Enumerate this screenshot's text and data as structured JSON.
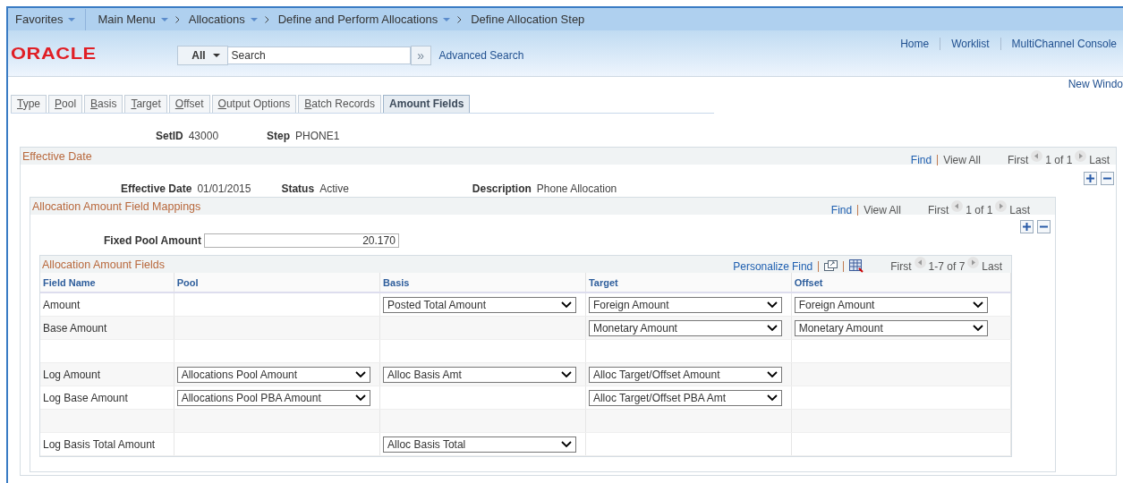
{
  "nav": {
    "items": [
      {
        "label": "Favorites",
        "has_menu": true,
        "separator": false
      },
      {
        "label": "Main Menu",
        "has_menu": true,
        "separator": false
      },
      {
        "label": "Allocations",
        "has_menu": true,
        "separator": true
      },
      {
        "label": "Define and Perform Allocations",
        "has_menu": true,
        "separator": true
      },
      {
        "label": "Define Allocation Step",
        "has_menu": false,
        "separator": true
      }
    ]
  },
  "header": {
    "logo": "ORACLE",
    "search_scope": "All",
    "search_placeholder": "Search",
    "search_go": "»",
    "advanced_search": "Advanced Search",
    "links": [
      "Home",
      "Worklist",
      "MultiChannel Console"
    ]
  },
  "new_window": "New Windo",
  "tabs": [
    {
      "label": "Type",
      "selected": false
    },
    {
      "label": "Pool",
      "selected": false
    },
    {
      "label": "Basis",
      "selected": false
    },
    {
      "label": "Target",
      "selected": false
    },
    {
      "label": "Offset",
      "selected": false
    },
    {
      "label": "Output Options",
      "selected": false
    },
    {
      "label": "Batch Records",
      "selected": false
    },
    {
      "label": "Amount Fields",
      "selected": true
    }
  ],
  "keys": [
    {
      "label": "SetID",
      "value": "43000"
    },
    {
      "label": "Step",
      "value": "PHONE1"
    }
  ],
  "effective_date_section": {
    "title": "Effective Date",
    "find": "Find",
    "view_all": "View All",
    "first": "First",
    "count": "1 of 1",
    "last": "Last",
    "fields": [
      {
        "label": "Effective Date",
        "value": "01/01/2015"
      },
      {
        "label": "Status",
        "value": "Active"
      },
      {
        "label": "Description",
        "value": "Phone Allocation"
      }
    ]
  },
  "mapping_section": {
    "title": "Allocation Amount Field Mappings",
    "find": "Find",
    "view_all": "View All",
    "first": "First",
    "count": "1 of 1",
    "last": "Last",
    "fixed_pool_label": "Fixed Pool Amount",
    "fixed_pool_value": "20.170"
  },
  "grid": {
    "title": "Allocation Amount Fields",
    "personalize": "Personalize",
    "find": "Find",
    "first": "First",
    "count": "1-7 of 7",
    "last": "Last",
    "columns": [
      "Field Name",
      "Pool",
      "Basis",
      "Target",
      "Offset"
    ],
    "rows": [
      {
        "cells": [
          "Amount",
          null,
          "Posted Total Amount",
          "Foreign Amount",
          "Foreign Amount"
        ]
      },
      {
        "cells": [
          "Base Amount",
          null,
          null,
          "Monetary Amount",
          "Monetary Amount"
        ]
      },
      {
        "cells": [
          null,
          null,
          null,
          null,
          null
        ]
      },
      {
        "cells": [
          "Log Amount",
          "Allocations Pool Amount",
          "Alloc Basis Amt",
          "Alloc Target/Offset Amount",
          null
        ]
      },
      {
        "cells": [
          "Log Base Amount",
          "Allocations Pool PBA Amount",
          null,
          "Alloc Target/Offset PBA Amt",
          null
        ]
      },
      {
        "cells": [
          null,
          null,
          null,
          null,
          null
        ]
      },
      {
        "cells": [
          "Log Basis Total Amount",
          null,
          "Alloc Basis Total",
          null,
          null
        ]
      }
    ]
  }
}
